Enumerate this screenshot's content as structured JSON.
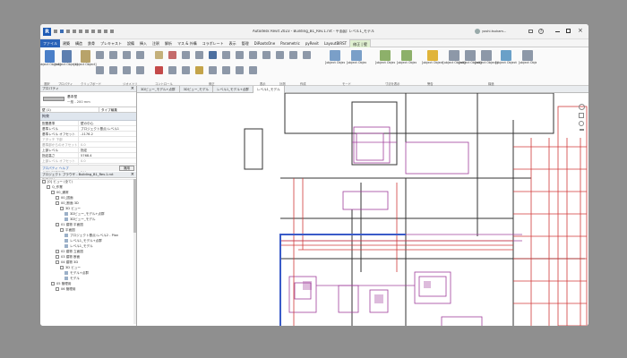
{
  "app": {
    "title": "Autodesk Revit 2023 - Building_B1_Rev.1.rvt - 平面図: レベル1_モデル",
    "user": "yoshi.tsukam..."
  },
  "ribbon_tabs": [
    "ファイル",
    "建築",
    "構造",
    "鉄骨",
    "プレキャスト",
    "設備",
    "挿入",
    "注釈",
    "解析",
    "マス & 外構",
    "コラボレート",
    "表示",
    "管理",
    "DiRootsOne",
    "Parametric",
    "pyRevit",
    "LayoutBIRST",
    "修正 | 壁"
  ],
  "ribbon_groups": [
    {
      "label": "選択"
    },
    {
      "label": "プロパティ"
    },
    {
      "label": "クリップボード"
    },
    {
      "label": "ジオメトリ"
    },
    {
      "label": "コントロール"
    },
    {
      "label": "修正"
    },
    {
      "label": "表示"
    },
    {
      "label": "計測"
    },
    {
      "label": "作成"
    },
    {
      "label": "モード"
    },
    {
      "label": "寸法を表示"
    },
    {
      "label": "警告"
    },
    {
      "label": "構造"
    }
  ],
  "ribbon_buttons": [
    {
      "label": "修正"
    },
    {
      "label": "プロパティ"
    },
    {
      "label": "貼り付け"
    },
    {
      "label": "プロファイルを編集"
    },
    {
      "label": "プロファイルをリセット"
    },
    {
      "label": "アタッチ 上部/下部"
    },
    {
      "label": "アタッチ解除 上部/下部"
    },
    {
      "label": "関連した警告を表示"
    },
    {
      "label": "挿入"
    },
    {
      "label": "壁を分割"
    },
    {
      "label": "エリア"
    },
    {
      "label": "オペレーション エリア"
    },
    {
      "label": "オペラ エリア"
    }
  ],
  "properties": {
    "header": "プロパティ",
    "type_name": "基本壁",
    "type_sub": "一般 - 200 mm",
    "category": "壁 (1)",
    "edit_type": "タイプ編集",
    "section": "拘束",
    "rows": [
      {
        "k": "配置基準",
        "v": "壁の中心"
      },
      {
        "k": "基準レベル",
        "v": "プロジェクト基点:レベル1"
      },
      {
        "k": "基準レベル オフセット",
        "v": "-1176.2"
      },
      {
        "k": "アタッチ 下部",
        "v": "",
        "gray": true
      },
      {
        "k": "基準部からのオフセット",
        "v": "0.0",
        "gray": true
      },
      {
        "k": "上部レベル",
        "v": "指定"
      },
      {
        "k": "指定高さ",
        "v": "5768.4"
      },
      {
        "k": "上部レベル オフセット",
        "v": "0.0",
        "gray": true
      },
      {
        "k": "アタッチ 上部",
        "v": "",
        "gray": true
      },
      {
        "k": "上部の延長距離",
        "v": "0.0",
        "gray": true
      },
      {
        "k": "部屋境界",
        "v": "☑"
      }
    ],
    "help": "プロパティ ヘルプ",
    "apply": "適用"
  },
  "browser": {
    "header": "プロジェクト ブラウザ - Building_B1_Rev.1.rvt",
    "items": [
      {
        "label": "[0] ビュー (全て)",
        "depth": 0
      },
      {
        "label": "Q_作業",
        "depth": 1
      },
      {
        "label": "00_通常",
        "depth": 2
      },
      {
        "label": "00_図面",
        "depth": 3
      },
      {
        "label": "00_断面 3D",
        "depth": 3
      },
      {
        "label": "3D ビュー",
        "depth": 4
      },
      {
        "label": "3Dビュー_モデル+点群",
        "depth": 5
      },
      {
        "label": "3Dビュー_モデル",
        "depth": 5
      },
      {
        "label": "01 建物 平面図",
        "depth": 3
      },
      {
        "label": "平面図",
        "depth": 4
      },
      {
        "label": "プロジェクト基点:レベル2 - Plan",
        "depth": 5
      },
      {
        "label": "レベル1_モデル+点群",
        "depth": 5
      },
      {
        "label": "レベル1_モデル",
        "depth": 5
      },
      {
        "label": "02 建物 立面図",
        "depth": 3
      },
      {
        "label": "03 建物 断面",
        "depth": 3
      },
      {
        "label": "04 建物 3D",
        "depth": 3
      },
      {
        "label": "3D ビュー",
        "depth": 4
      },
      {
        "label": "モデル+点群",
        "depth": 5
      },
      {
        "label": "モデル",
        "depth": 5
      },
      {
        "label": "05 管理用",
        "depth": 2
      },
      {
        "label": "06 管理用",
        "depth": 3
      }
    ]
  },
  "view_tabs": [
    {
      "label": "3Dビュー_モデル+点群",
      "active": false
    },
    {
      "label": "3Dビュー_モデル",
      "active": false
    },
    {
      "label": "レベル1_モデル+点群",
      "active": false
    },
    {
      "label": "レベル1_モデル",
      "active": true
    }
  ]
}
